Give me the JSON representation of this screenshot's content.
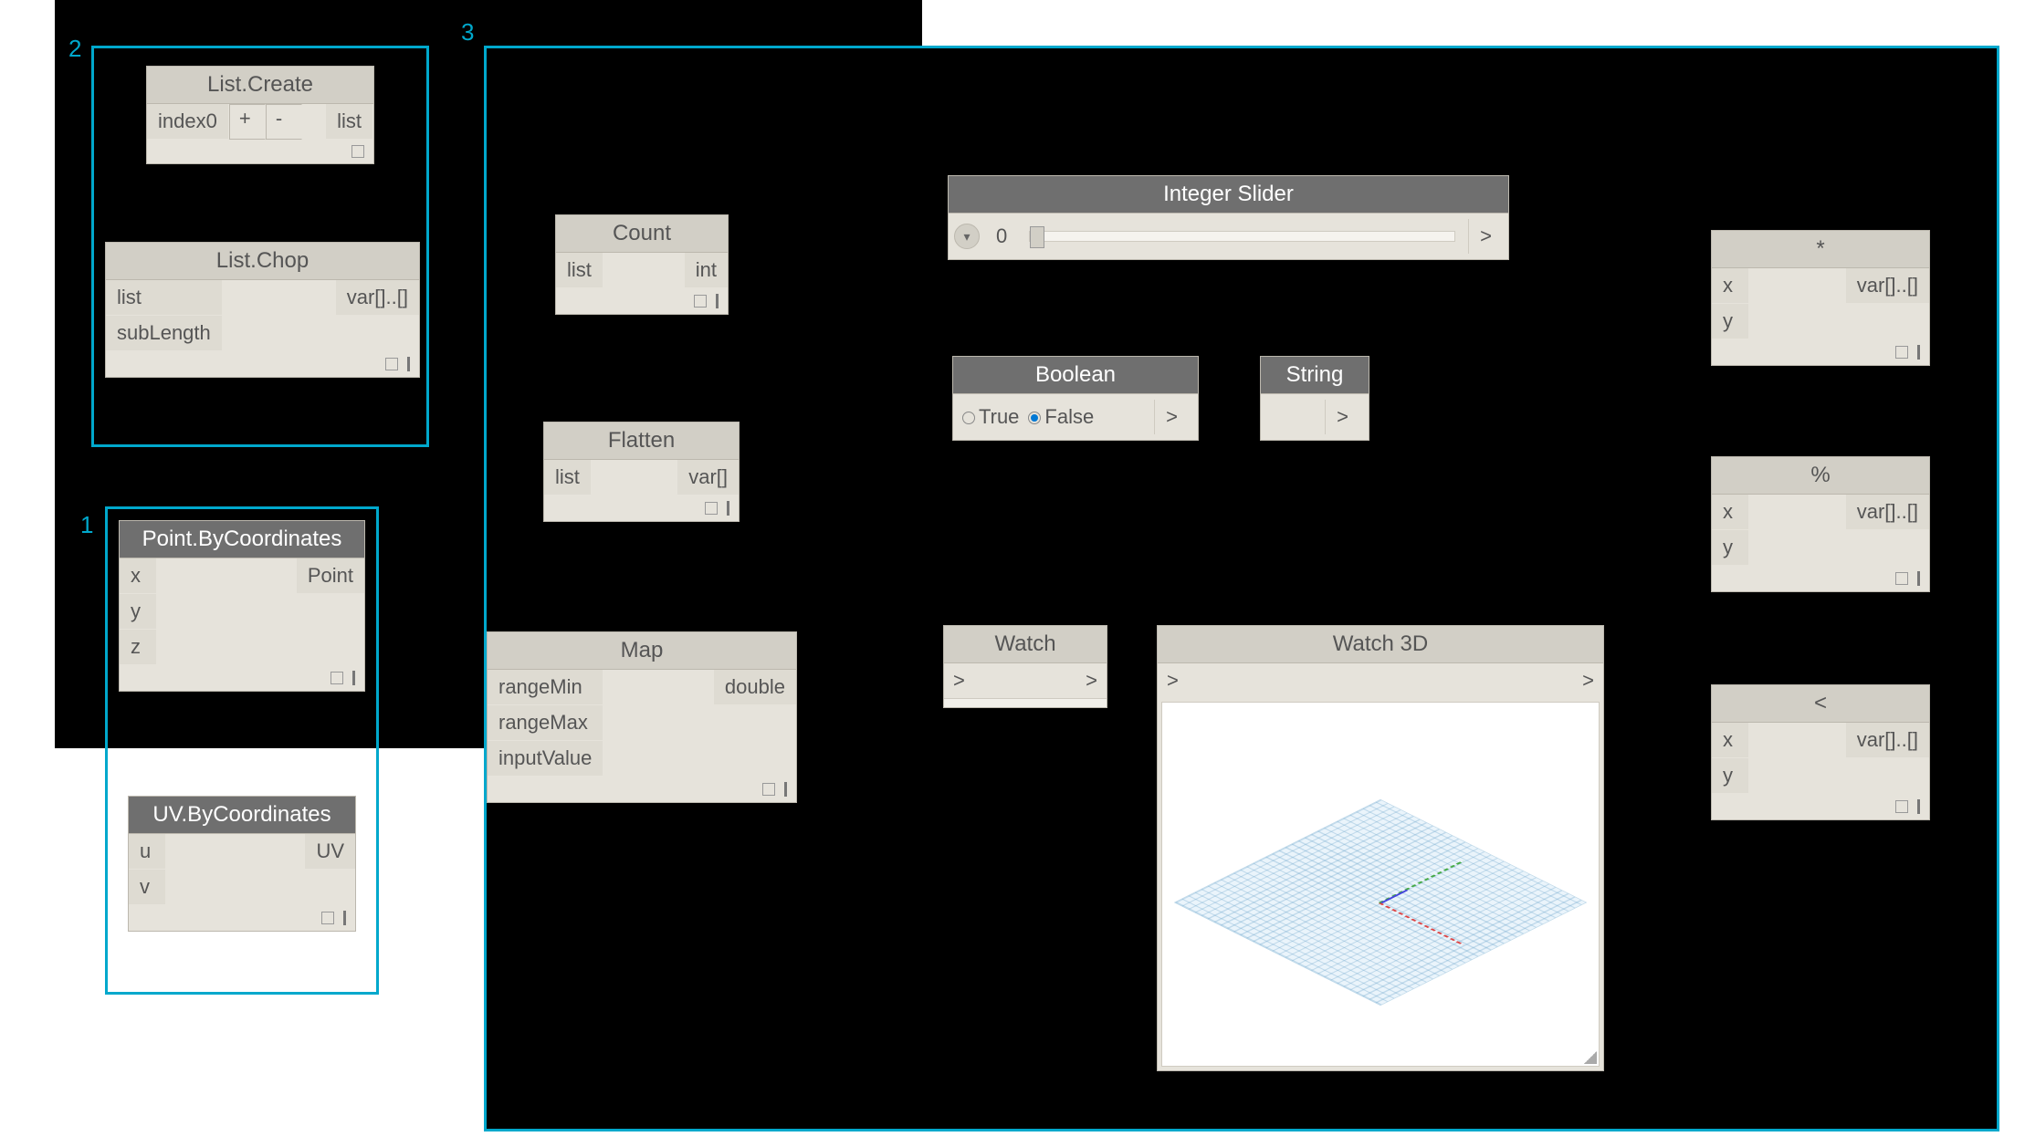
{
  "regions": {
    "r1": "1",
    "r2": "2",
    "r3": "3"
  },
  "nodes": {
    "listCreate": {
      "title": "List.Create",
      "in_index0": "index0",
      "btn_plus": "+",
      "btn_minus": "-",
      "out_list": "list"
    },
    "listChop": {
      "title": "List.Chop",
      "in_list": "list",
      "in_subLength": "subLength",
      "out": "var[]..[]"
    },
    "pointByCoords": {
      "title": "Point.ByCoordinates",
      "in_x": "x",
      "in_y": "y",
      "in_z": "z",
      "out": "Point"
    },
    "uvByCoords": {
      "title": "UV.ByCoordinates",
      "in_u": "u",
      "in_v": "v",
      "out": "UV"
    },
    "count": {
      "title": "Count",
      "in_list": "list",
      "out": "int"
    },
    "flatten": {
      "title": "Flatten",
      "in_list": "list",
      "out": "var[]"
    },
    "map": {
      "title": "Map",
      "in_rangeMin": "rangeMin",
      "in_rangeMax": "rangeMax",
      "in_inputValue": "inputValue",
      "out": "double"
    },
    "intSlider": {
      "title": "Integer Slider",
      "value": "0",
      "out": ">"
    },
    "boolean": {
      "title": "Boolean",
      "opt_true": "True",
      "opt_false": "False",
      "out": ">"
    },
    "string": {
      "title": "String",
      "out": ">"
    },
    "watch": {
      "title": "Watch",
      "in": ">",
      "out": ">"
    },
    "watch3d": {
      "title": "Watch 3D",
      "in": ">",
      "out": ">"
    },
    "multiply": {
      "title": "*",
      "in_x": "x",
      "in_y": "y",
      "out": "var[]..[]"
    },
    "modulo": {
      "title": "%",
      "in_x": "x",
      "in_y": "y",
      "out": "var[]..[]"
    },
    "lessThan": {
      "title": "<",
      "in_x": "x",
      "in_y": "y",
      "out": "var[]..[]"
    }
  }
}
